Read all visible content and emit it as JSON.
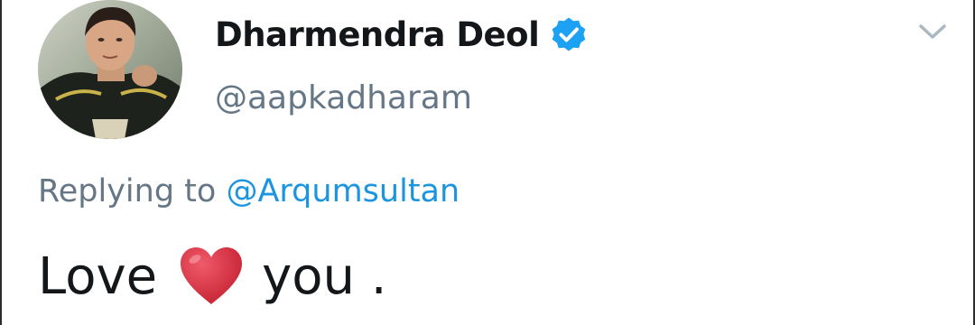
{
  "tweet": {
    "author": {
      "display_name": "Dharmendra Deol",
      "handle": "@aapkadharam",
      "verified": true,
      "avatar_icon": "profile-photo"
    },
    "menu_icon": "chevron-down-icon",
    "reply": {
      "prefix": "Replying to",
      "mention": "@Arqumsultan"
    },
    "text": {
      "before_emoji": "Love",
      "emoji": "red-heart",
      "after_emoji": "you ."
    }
  },
  "colors": {
    "name_text": "#14171a",
    "secondary_text": "#657786",
    "link_blue": "#1b95e0",
    "verified_blue": "#1da1f2",
    "heart_red": "#dd2e44",
    "chevron_gray": "#aab8c2"
  }
}
